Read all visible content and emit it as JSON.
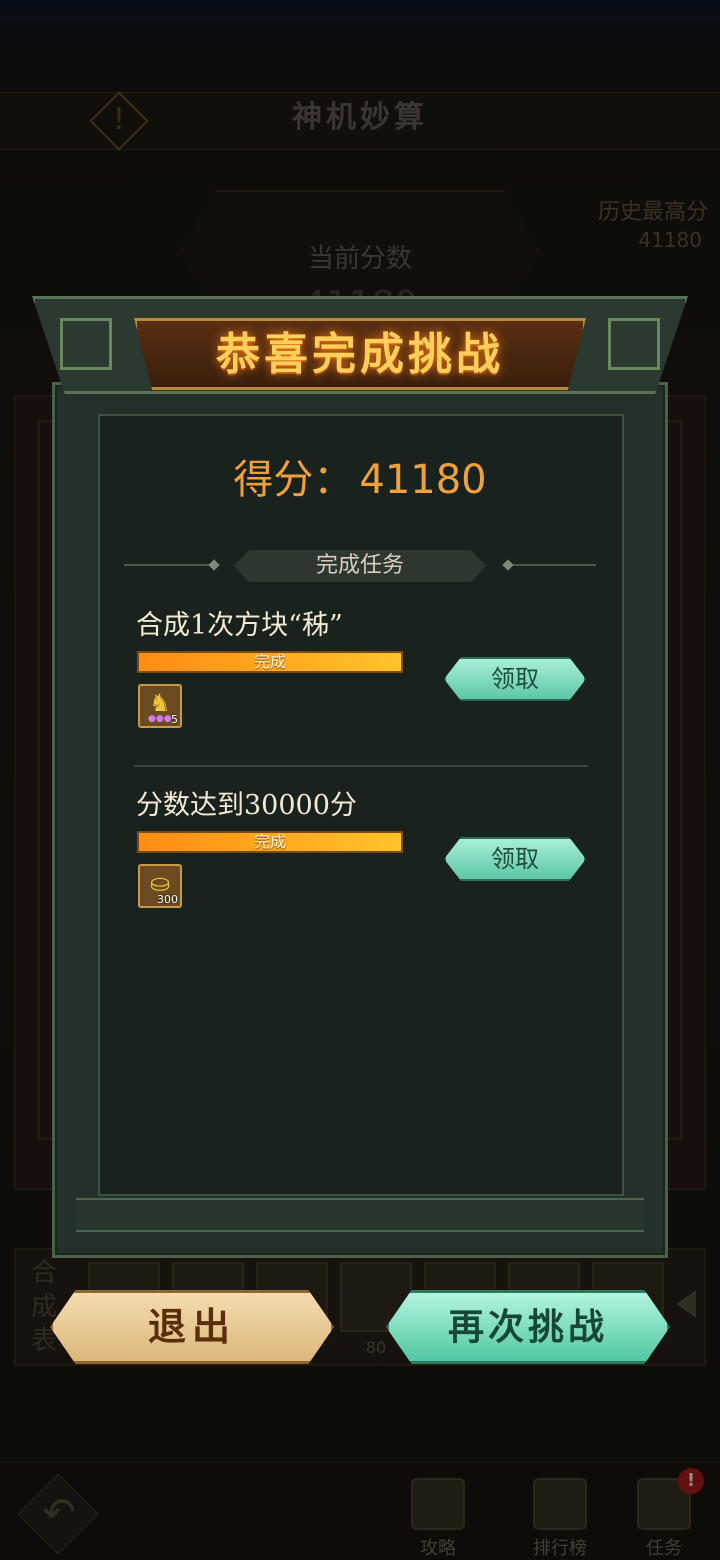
{
  "background": {
    "title": "神机妙算",
    "best_score_label": "历史最高分",
    "best_score_value": "41180",
    "current_score_label": "当前分数",
    "current_score_value": "41180",
    "synthesis_table_label": "合成表",
    "tile_value": "80",
    "nav": {
      "guide_label": "攻略",
      "ranking_label": "排行榜",
      "tasks_label": "任务",
      "tasks_badge": "!"
    }
  },
  "modal": {
    "banner_title": "恭喜完成挑战",
    "score_label": "得分：",
    "score_value": "41180",
    "section_title": "完成任务",
    "tasks": [
      {
        "title": "合成1次方块“秭”",
        "progress_text": "完成",
        "progress": 1.0,
        "reward_icon": "gold-figure-icon",
        "reward_count": "5",
        "claim_label": "领取"
      },
      {
        "title": "分数达到30000分",
        "progress_text": "完成",
        "progress": 1.0,
        "reward_icon": "gold-ingot-icon",
        "reward_count": "300",
        "claim_label": "领取"
      }
    ],
    "exit_label": "退出",
    "retry_label": "再次挑战"
  },
  "colors": {
    "banner_text": "#ffcf5a",
    "score_text": "#f2a13a",
    "progress_fill": "#ffb01c",
    "claim_button": "#5dc7a8",
    "exit_button": "#dcb77c",
    "retry_button": "#4fc7a2",
    "badge": "#b3201e"
  }
}
